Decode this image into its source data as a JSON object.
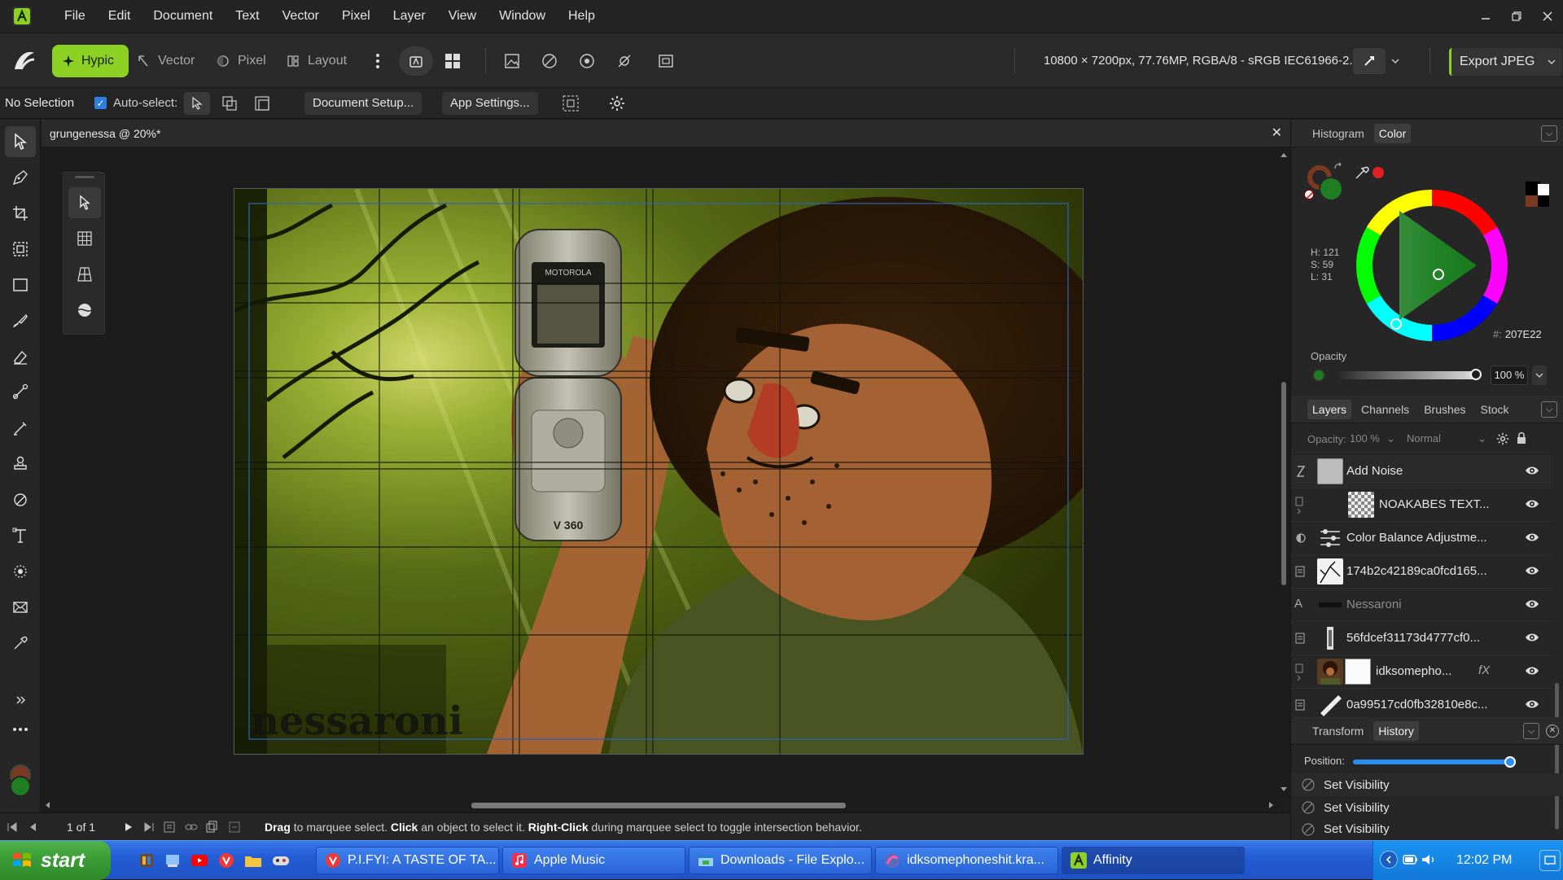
{
  "menu": {
    "items": [
      "File",
      "Edit",
      "Document",
      "Text",
      "Vector",
      "Pixel",
      "Layer",
      "View",
      "Window",
      "Help"
    ]
  },
  "toolbar": {
    "personas": [
      {
        "label": "Hypic",
        "icon": "hypic-persona-icon"
      },
      {
        "label": "Vector",
        "icon": "vector-persona-icon"
      },
      {
        "label": "Pixel",
        "icon": "pixel-persona-icon"
      },
      {
        "label": "Layout",
        "icon": "layout-persona-icon"
      }
    ],
    "document_info": "10800 × 7200px, 77.76MP, RGBA/8 - sRGB IEC61966-2.1",
    "export_label": "Export JPEG",
    "accent_color": "#8DD124"
  },
  "context_bar": {
    "selection_status": "No Selection",
    "auto_select_label": "Auto-select:",
    "auto_select_checked": true,
    "document_setup_label": "Document Setup...",
    "app_settings_label": "App Settings..."
  },
  "left_tools": [
    "move-tool-icon",
    "pen-tool-icon",
    "crop-tool-icon",
    "selection-tool-icon",
    "rectangle-tool-icon",
    "brush-tool-icon",
    "eraser-tool-icon",
    "paint-tool-icon",
    "smudge-tool-icon",
    "clone-tool-icon",
    "retouch-tool-icon",
    "text-tool-icon",
    "blur-tool-icon",
    "mail-icon",
    "color-picker-icon"
  ],
  "document": {
    "tab_title": "grungenessa @ 20%*",
    "page_indicator": "1 of 1",
    "status_hint": [
      {
        "bold": "Drag",
        "text": " to marquee select. "
      },
      {
        "bold": "Click",
        "text": " an object to select it. "
      },
      {
        "bold": "Right-Click",
        "text": " during marquee select to toggle intersection behavior."
      }
    ]
  },
  "artwork": {
    "phone_brand": "MOTOROLA",
    "phone_model": "V 360",
    "watermark_text": "nessaroni"
  },
  "color_panel": {
    "tabs": [
      {
        "label": "Histogram",
        "active": false
      },
      {
        "label": "Color",
        "active": true
      }
    ],
    "h": "H: 121",
    "s": "S: 59",
    "l": "L: 31",
    "hex": "207E22",
    "hex_prefix": "#:",
    "opacity_label": "Opacity",
    "opacity_value": "100 %",
    "primary_color": "#207E22",
    "secondary_color": "#7A3A22"
  },
  "layers_panel": {
    "tabs": [
      {
        "label": "Layers",
        "active": true
      },
      {
        "label": "Channels",
        "active": false
      },
      {
        "label": "Brushes",
        "active": false
      },
      {
        "label": "Stock",
        "active": false
      }
    ],
    "opacity_label": "Opacity:",
    "opacity_value": "100 %",
    "blend_mode": "Normal",
    "layers": [
      {
        "name": "Add Noise",
        "indent": false,
        "visible": true
      },
      {
        "name": "NOAKABES TEXT...",
        "indent": true,
        "visible": true
      },
      {
        "name": "Color Balance Adjustme...",
        "indent": false,
        "visible": true
      },
      {
        "name": "174b2c42189ca0fcd165...",
        "indent": false,
        "visible": true
      },
      {
        "name": "Nessaroni",
        "indent": false,
        "visible": true,
        "dim": true
      },
      {
        "name": "56fdcef31173d4777cf0...",
        "indent": false,
        "visible": true
      },
      {
        "name": "idksomepho...",
        "indent": true,
        "visible": true,
        "fx": "fX"
      },
      {
        "name": "0a99517cd0fb32810e8c...",
        "indent": false,
        "visible": true
      }
    ]
  },
  "history_panel": {
    "tabs": [
      {
        "label": "Transform",
        "active": false
      },
      {
        "label": "History",
        "active": true
      }
    ],
    "position_label": "Position:",
    "position_value": 1.0,
    "items": [
      "Set Visibility",
      "Set Visibility",
      "Set Visibility"
    ]
  },
  "taskbar": {
    "start_label": "start",
    "items": [
      {
        "label": "P.I.FYI: A TASTE OF TA...",
        "icon": "vivaldi-icon",
        "active": false
      },
      {
        "label": "Apple Music",
        "icon": "apple-music-icon",
        "active": false
      },
      {
        "label": "Downloads - File Explo...",
        "icon": "file-explorer-icon",
        "active": false
      },
      {
        "label": "idksomephoneshit.kra...",
        "icon": "krita-icon",
        "active": false
      },
      {
        "label": "Affinity",
        "icon": "affinity-icon",
        "active": true
      }
    ],
    "clock": "12:02 PM"
  }
}
